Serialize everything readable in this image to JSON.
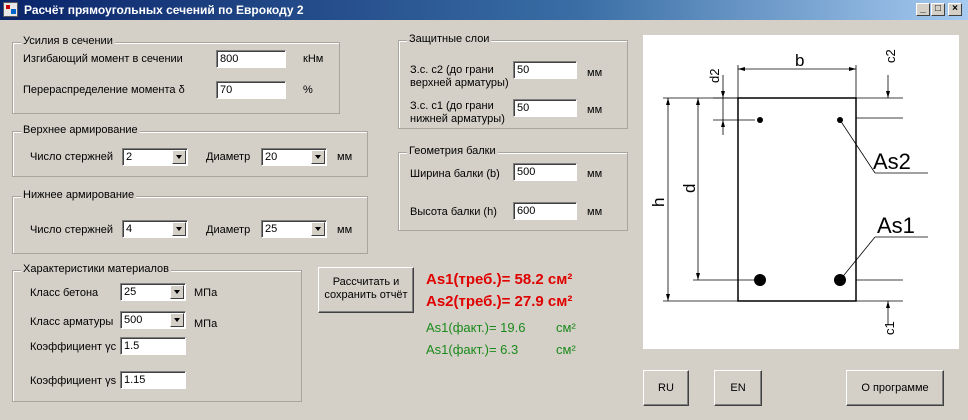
{
  "window": {
    "title": "Расчёт прямоугольных сечений по Еврокоду 2"
  },
  "forces": {
    "legend": "Усилия в сечении",
    "moment_label": "Изгибающий момент в сечении",
    "moment_value": "800",
    "moment_unit": "кНм",
    "redistribution_label": "Перераспределение момента δ",
    "redistribution_value": "70",
    "redistribution_unit": "%"
  },
  "top_reinf": {
    "legend": "Верхнее армирование",
    "count_label": "Число стержней",
    "count_value": "2",
    "diameter_label": "Диаметр",
    "diameter_value": "20",
    "unit": "мм"
  },
  "bottom_reinf": {
    "legend": "Нижнее армирование",
    "count_label": "Число стержней",
    "count_value": "4",
    "diameter_label": "Диаметр",
    "diameter_value": "25",
    "unit": "мм"
  },
  "materials": {
    "legend": "Характеристики материалов",
    "concrete_label": "Класс бетона",
    "concrete_value": "25",
    "concrete_unit": "МПа",
    "steel_label": "Класс арматуры",
    "steel_value": "500",
    "steel_unit": "МПа",
    "gamma_c_label": "Коэффициент γc",
    "gamma_c_value": "1.5",
    "gamma_s_label": "Коэффициент γs",
    "gamma_s_value": "1.15"
  },
  "cover": {
    "legend": "Защитные слои",
    "c2_label_1": "З.с. с2 (до грани",
    "c2_label_2": "верхней арматуры)",
    "c2_value": "50",
    "c1_label_1": "З.с. с1 (до грани",
    "c1_label_2": "нижней арматуры)",
    "c1_value": "50",
    "unit": "мм"
  },
  "geometry": {
    "legend": "Геометрия балки",
    "width_label": "Ширина балки (b)",
    "width_value": "500",
    "height_label": "Высота балки (h)",
    "height_value": "600",
    "unit": "мм"
  },
  "actions": {
    "calc_line1": "Рассчитать и",
    "calc_line2": "сохранить отчёт",
    "ru": "RU",
    "en": "EN",
    "about": "О программе"
  },
  "results": {
    "as1_req": "As1(треб.)= 58.2 см²",
    "as2_req": "As2(треб.)= 27.9 см²",
    "as1_fact_text": "As1(факт.)= 19.6",
    "as1_fact_unit": "см²",
    "as2_fact_text": "As1(факт.)= 6.3",
    "as2_fact_unit": "см²"
  },
  "diagram": {
    "b": "b",
    "h": "h",
    "d": "d",
    "d2": "d2",
    "c2": "c2",
    "c1": "c1",
    "as2": "As2",
    "as1": "As1"
  }
}
